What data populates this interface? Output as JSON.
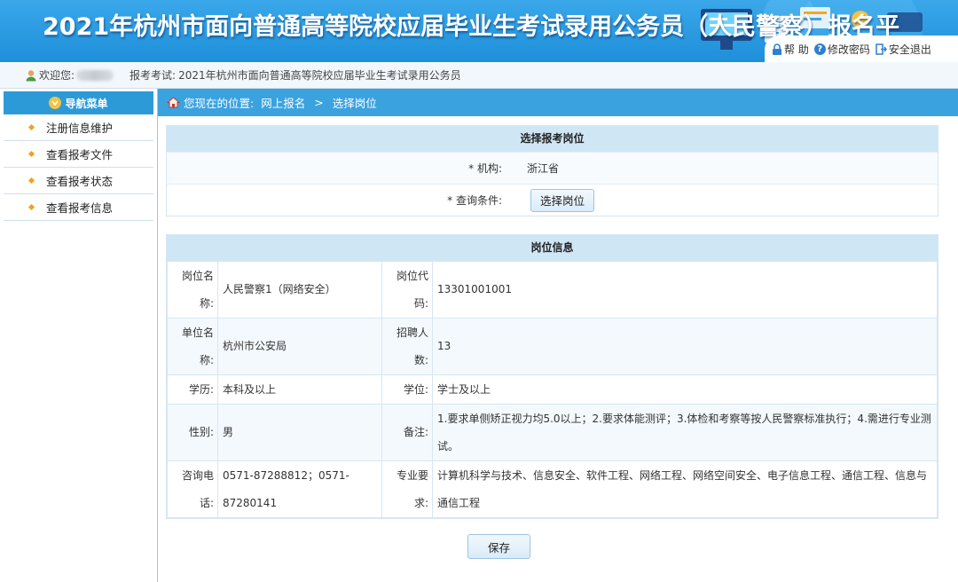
{
  "banner": {
    "title": "2021年杭州市面向普通高等院校应届毕业生考试录用公务员（人民警察）报名平",
    "help": "帮 助",
    "change_password": "修改密码",
    "logout": "安全退出"
  },
  "infobar": {
    "welcome": "欢迎您:",
    "exam_label": "报考考试:",
    "exam_name": "2021年杭州市面向普通高等院校应届毕业生考试录用公务员"
  },
  "sidebar": {
    "title": "导航菜单",
    "items": [
      {
        "label": "注册信息维护"
      },
      {
        "label": "查看报考文件"
      },
      {
        "label": "查看报考状态"
      },
      {
        "label": "查看报考信息"
      }
    ]
  },
  "breadcrumb": {
    "prefix": "您现在的位置:",
    "level1": "网上报名",
    "sep": ">",
    "level2": "选择岗位"
  },
  "select_panel": {
    "title": "选择报考岗位",
    "org_label": "* 机构:",
    "org_value": "浙江省",
    "query_label": "* 查询条件:",
    "choose_button": "选择岗位"
  },
  "info_panel": {
    "title": "岗位信息",
    "rows": [
      {
        "k1": "岗位名称:",
        "v1": "人民警察1（网络安全）",
        "k2": "岗位代码:",
        "v2": "13301001001"
      },
      {
        "k1": "单位名称:",
        "v1": "杭州市公安局",
        "k2": "招聘人数:",
        "v2": "13"
      },
      {
        "k1": "学历:",
        "v1": "本科及以上",
        "k2": "学位:",
        "v2": "学士及以上"
      },
      {
        "k1": "性别:",
        "v1": "男",
        "k2": "备注:",
        "v2": "1.要求单侧矫正视力均5.0以上；2.要求体能测评；3.体检和考察等按人民警察标准执行；4.需进行专业测试。"
      },
      {
        "k1": "咨询电话:",
        "v1": "0571-87288812；0571-87280141",
        "k2": "专业要求:",
        "v2": "计算机科学与技术、信息安全、软件工程、网络工程、网络空间安全、电子信息工程、通信工程、信息与通信工程"
      }
    ]
  },
  "actions": {
    "save": "保存"
  },
  "colors": {
    "banner": "#1e8fd9",
    "nav_header": "#2d9ad8",
    "breadcrumb_bar": "#3ba2e0",
    "panel_header": "#cfe6f5"
  }
}
